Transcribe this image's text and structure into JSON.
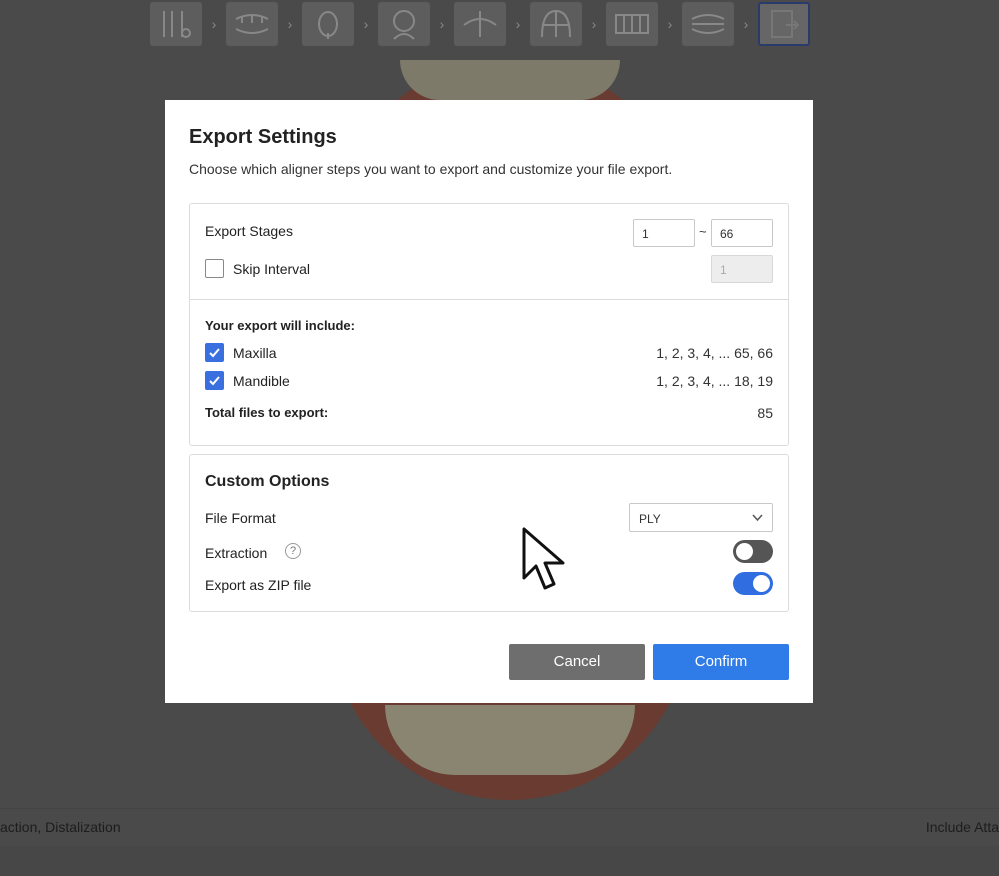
{
  "background": {
    "toolbar_icons": [
      "caliper-icon",
      "teeth-icon",
      "tooth-icon",
      "head-icon",
      "jaw-icon",
      "arch-grid-icon",
      "teeth-grid-icon",
      "aligner-icon",
      "export-icon"
    ],
    "bottom_left_text": "action, Distalization",
    "bottom_right_text": "Include Atta"
  },
  "modal": {
    "title": "Export Settings",
    "subtitle": "Choose which aligner steps you want to export and customize your file export.",
    "stages": {
      "label": "Export Stages",
      "from": "1",
      "separator": "~",
      "to": "66",
      "skip_label": "Skip Interval",
      "skip_value": "1",
      "skip_checked": false
    },
    "include": {
      "heading": "Your export will include:",
      "maxilla_label": "Maxilla",
      "maxilla_value": "1, 2, 3, 4, ... 65, 66",
      "mandible_label": "Mandible",
      "mandible_value": "1, 2, 3, 4, ... 18, 19",
      "total_label": "Total files to export:",
      "total_value": "85"
    },
    "custom": {
      "heading": "Custom Options",
      "file_format_label": "File Format",
      "file_format_value": "PLY",
      "extraction_label": "Extraction",
      "extraction_help": "?",
      "extraction_on": false,
      "zip_label": "Export as ZIP file",
      "zip_on": true
    },
    "buttons": {
      "cancel": "Cancel",
      "confirm": "Confirm"
    },
    "colors": {
      "accent": "#2f7be7",
      "cancel_bg": "#6e6e6e"
    }
  }
}
